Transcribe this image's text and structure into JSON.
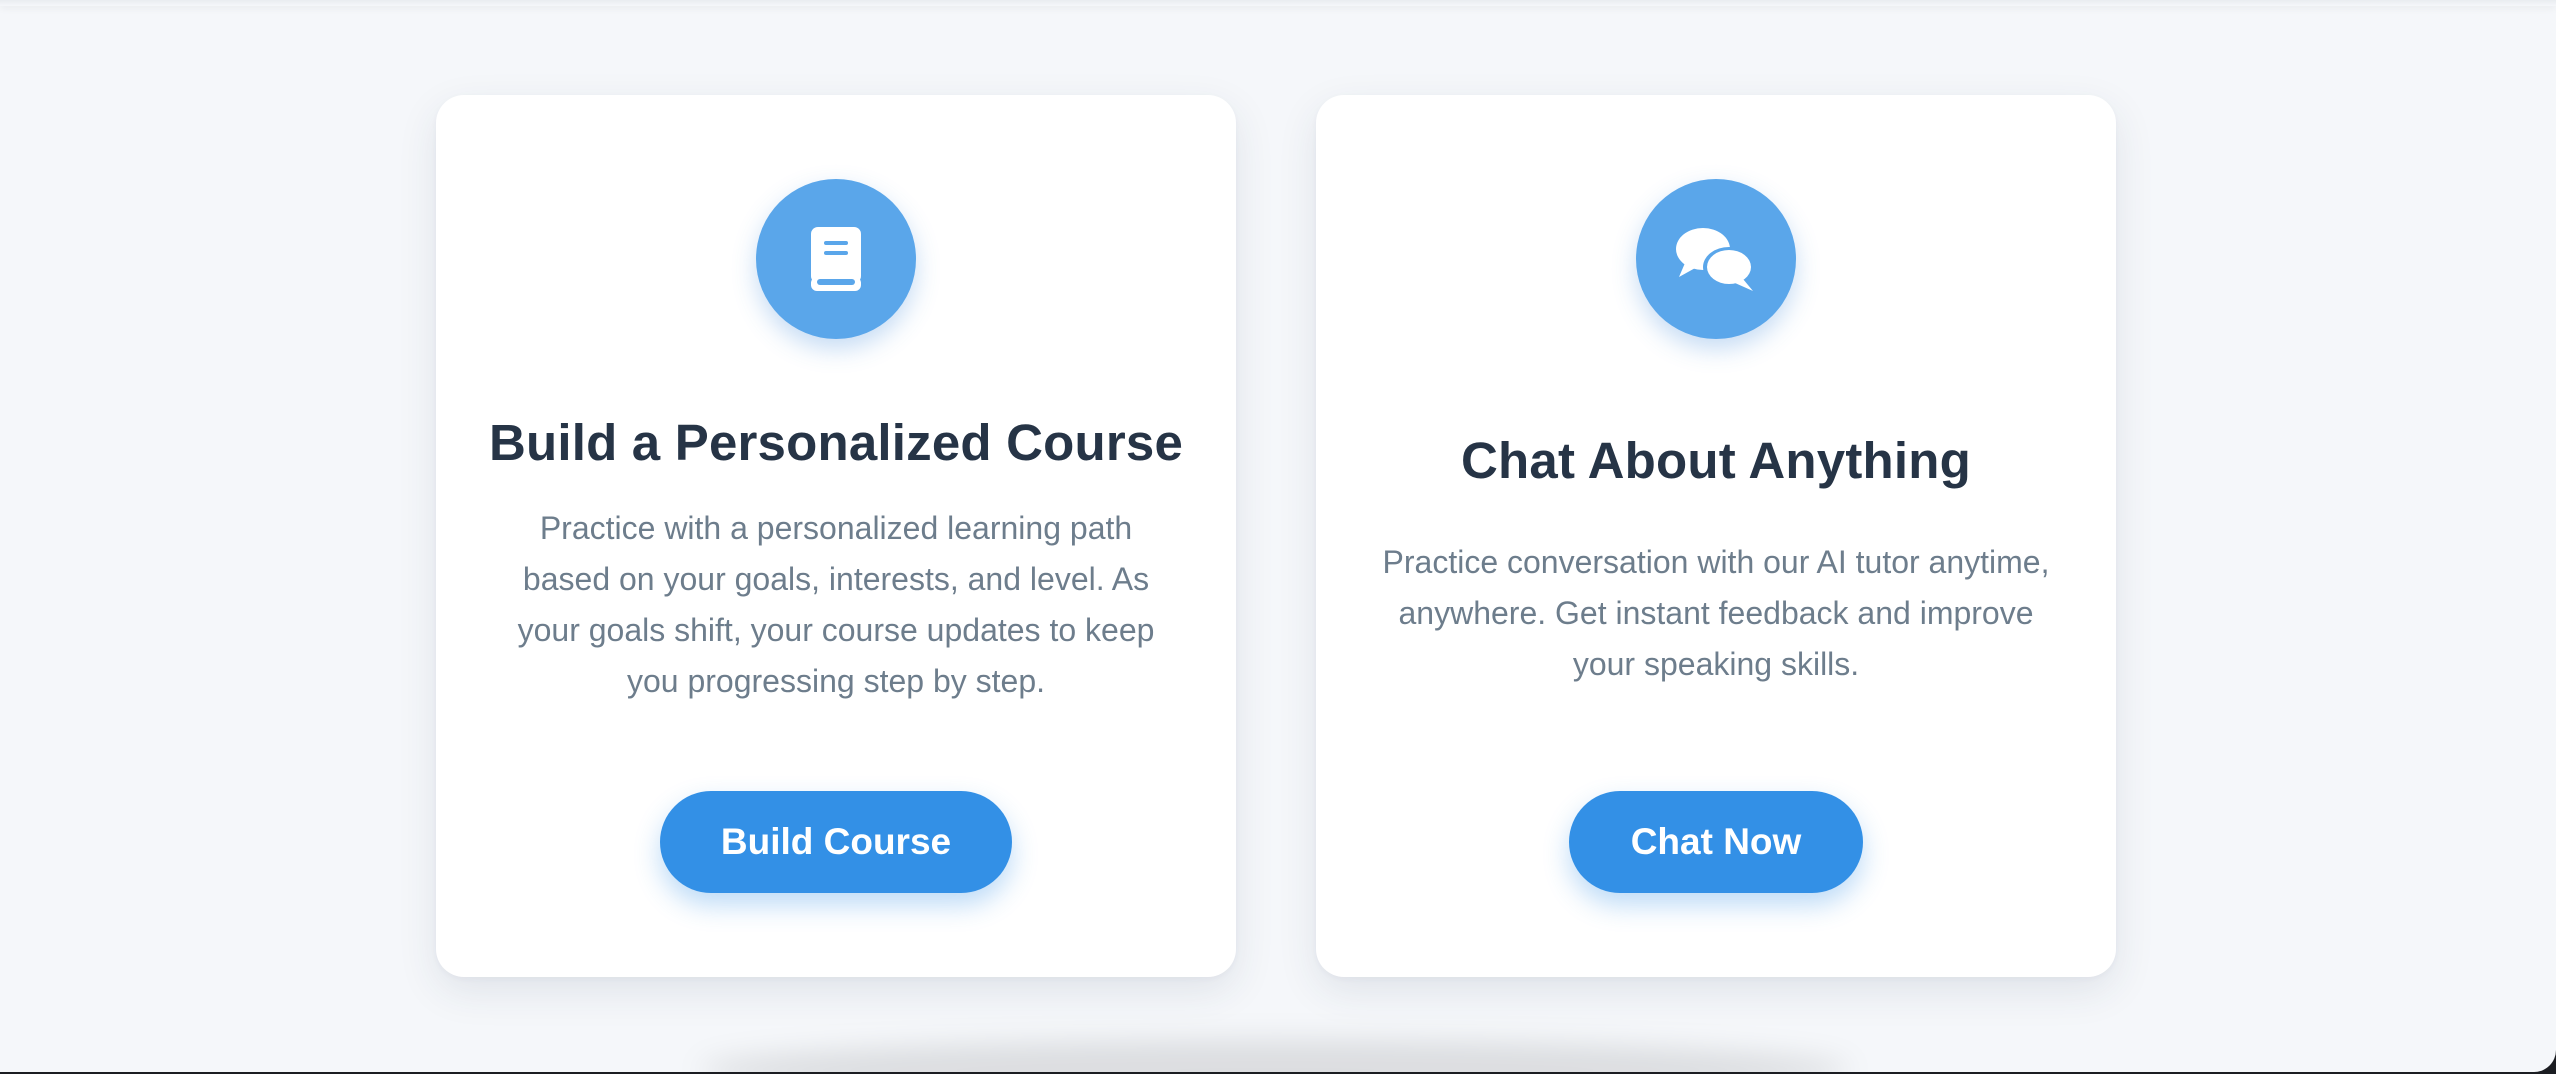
{
  "cards": [
    {
      "icon": "book-icon",
      "title": "Build a Personalized Course",
      "description": "Practice with a personalized learning path based on your goals, interests, and level. As your goals shift, your course updates to keep you progressing step by step.",
      "button_label": "Build Course"
    },
    {
      "icon": "chat-bubbles-icon",
      "title": "Chat About Anything",
      "description": "Practice conversation with our AI tutor anytime, anywhere. Get instant feedback and improve your speaking skills.",
      "button_label": "Chat Now"
    }
  ],
  "colors": {
    "background": "#f5f7fa",
    "card": "#ffffff",
    "icon_circle": "#5aa6ea",
    "button": "#3390e6",
    "title": "#263446",
    "description": "#6d7d8c"
  }
}
